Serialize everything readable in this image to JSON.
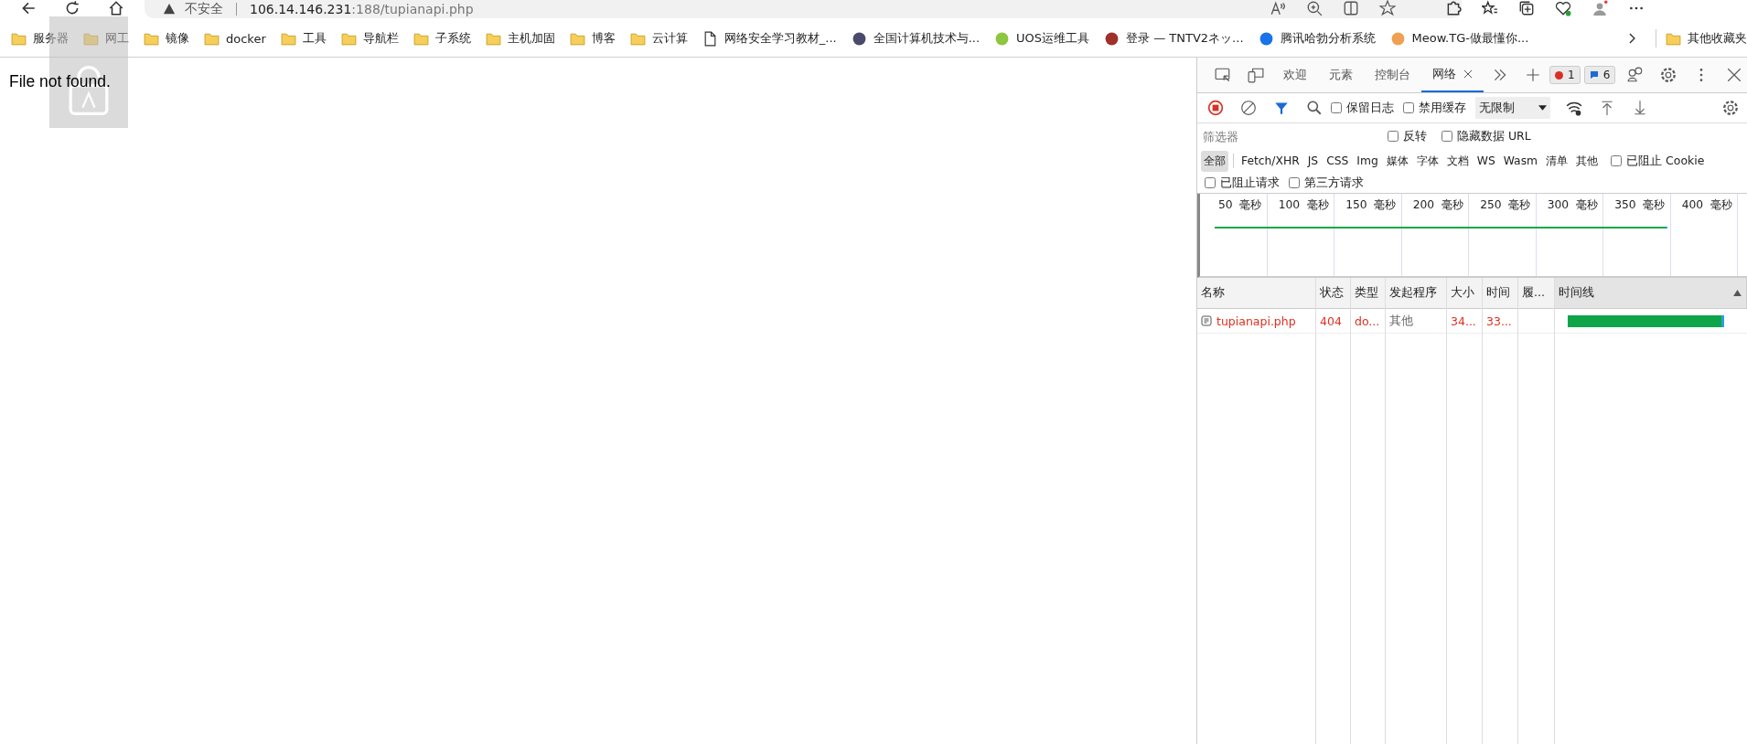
{
  "nav": {
    "security": "不安全",
    "host": "106.14.146.231",
    "path": ":188/tupianapi.php"
  },
  "bookmarks": [
    {
      "label": "服务器",
      "kind": "folder"
    },
    {
      "label": "网工",
      "kind": "folder"
    },
    {
      "label": "镜像",
      "kind": "folder"
    },
    {
      "label": "docker",
      "kind": "folder"
    },
    {
      "label": "工具",
      "kind": "folder"
    },
    {
      "label": "导航栏",
      "kind": "folder"
    },
    {
      "label": "子系统",
      "kind": "folder"
    },
    {
      "label": "主机加固",
      "kind": "folder"
    },
    {
      "label": "博客",
      "kind": "folder"
    },
    {
      "label": "云计算",
      "kind": "folder"
    },
    {
      "label": "网络安全学习教材_...",
      "kind": "page"
    },
    {
      "label": "全国计算机技术与...",
      "kind": "site",
      "color": "#4a4a6a"
    },
    {
      "label": "UOS运维工具",
      "kind": "site",
      "color": "#8dc63f"
    },
    {
      "label": "登录 — TNTV2ネッ...",
      "kind": "site",
      "color": "#a0302a"
    },
    {
      "label": "腾讯哈勃分析系统",
      "kind": "site",
      "color": "#1a73e8"
    },
    {
      "label": "Meow.TG-做最懂你...",
      "kind": "site",
      "color": "#f0a050"
    }
  ],
  "other_bookmarks": "其他收藏夹",
  "page": {
    "message": "File not found."
  },
  "devtools": {
    "tabs": [
      {
        "label": "欢迎",
        "selected": false
      },
      {
        "label": "元素",
        "selected": false
      },
      {
        "label": "控制台",
        "selected": false
      },
      {
        "label": "网络",
        "selected": true
      }
    ],
    "error_count": "1",
    "message_count": "6",
    "options": [
      {
        "label": "保留日志",
        "checked": false
      },
      {
        "label": "禁用缓存",
        "checked": false
      }
    ],
    "throttle": "无限制",
    "filter": {
      "placeholder": "筛选器"
    },
    "filter_options": [
      {
        "label": "反转",
        "checked": false
      },
      {
        "label": "隐藏数据 URL",
        "checked": false
      }
    ],
    "types": [
      {
        "label": "全部",
        "selected": true
      },
      {
        "label": "Fetch/XHR",
        "selected": false
      },
      {
        "label": "JS",
        "selected": false
      },
      {
        "label": "CSS",
        "selected": false
      },
      {
        "label": "Img",
        "selected": false
      },
      {
        "label": "媒体",
        "selected": false
      },
      {
        "label": "字体",
        "selected": false
      },
      {
        "label": "文档",
        "selected": false
      },
      {
        "label": "WS",
        "selected": false
      },
      {
        "label": "Wasm",
        "selected": false
      },
      {
        "label": "清单",
        "selected": false
      },
      {
        "label": "其他",
        "selected": false
      }
    ],
    "type_options": [
      {
        "label": "已阻止 Cookie",
        "checked": false
      }
    ],
    "request_options": [
      {
        "label": "已阻止请求",
        "checked": false
      },
      {
        "label": "第三方请求",
        "checked": false
      }
    ],
    "ticks": [
      "50  毫秒",
      "100  毫秒",
      "150  毫秒",
      "200  毫秒",
      "250  毫秒",
      "300  毫秒",
      "350  毫秒",
      "400  毫秒"
    ],
    "columns": [
      "名称",
      "状态",
      "类型",
      "发起程序",
      "大小",
      "时间",
      "履...",
      "时间线"
    ],
    "rows": [
      {
        "failed": true,
        "cells": [
          "tupianapi.php",
          "404",
          "do...",
          "其他",
          "34...",
          "33...",
          ""
        ]
      }
    ]
  }
}
